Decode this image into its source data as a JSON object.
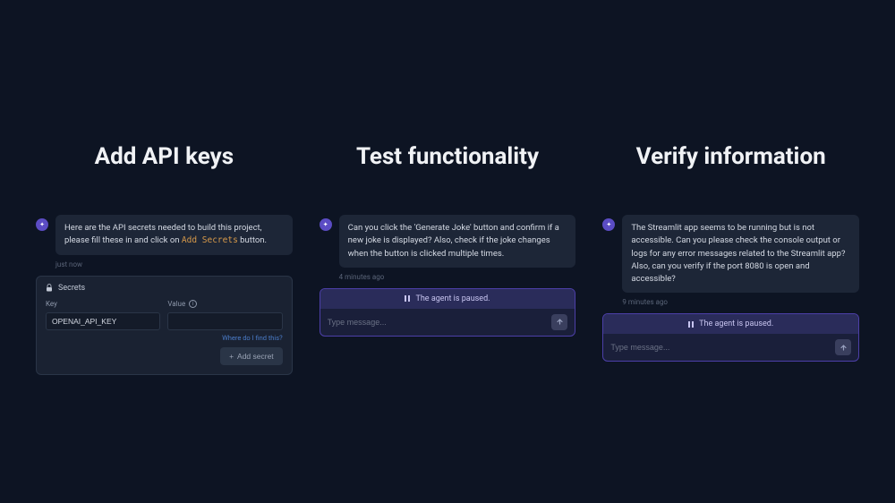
{
  "columns": {
    "left": {
      "title": "Add API keys",
      "message_prefix": "Here are the API secrets needed to build this project, please fill these in and click on ",
      "message_highlight": "Add Secrets",
      "message_suffix": " button.",
      "timestamp": "just now",
      "secrets": {
        "header": "Secrets",
        "key_label": "Key",
        "value_label": "Value",
        "key_value": "OPENAI_API_KEY",
        "value_value": "",
        "find_link": "Where do I find this?",
        "add_button": "Add secret"
      }
    },
    "middle": {
      "title": "Test functionality",
      "message": "Can you click the 'Generate Joke' button and confirm if a new joke is displayed? Also, check if the joke changes when the button is clicked multiple times.",
      "timestamp": "4 minutes ago",
      "paused": "The agent is paused.",
      "placeholder": "Type message..."
    },
    "right": {
      "title": "Verify information",
      "message": "The Streamlit app seems to be running but is not accessible. Can you please check the console output or logs for any error messages related to the Streamlit app? Also, can you verify if the port 8080 is open and accessible?",
      "timestamp": "9 minutes ago",
      "paused": "The agent is paused.",
      "placeholder": "Type message..."
    }
  }
}
